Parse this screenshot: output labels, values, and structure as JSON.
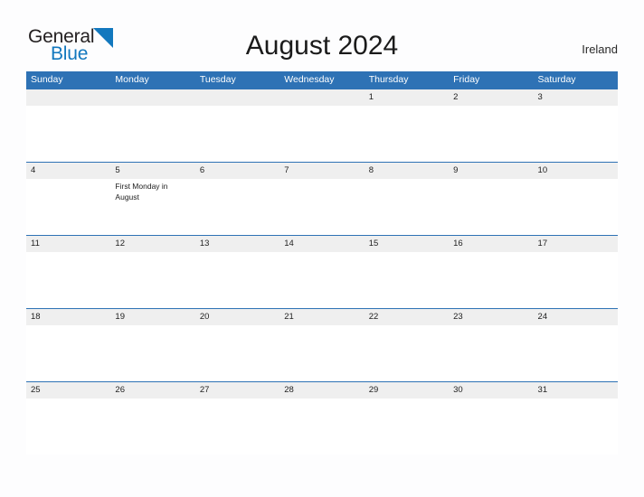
{
  "brand": {
    "name_part1": "General",
    "name_part2": "Blue",
    "flag_icon": "blue-triangle-flag-icon",
    "color_text": "#231f20",
    "color_accent": "#1278be"
  },
  "header": {
    "title": "August 2024",
    "country": "Ireland"
  },
  "calendar": {
    "header_bg": "#2e72b5",
    "band_bg": "#efefef",
    "weekdays": [
      "Sunday",
      "Monday",
      "Tuesday",
      "Wednesday",
      "Thursday",
      "Friday",
      "Saturday"
    ],
    "weeks": [
      {
        "days": [
          {
            "date": "",
            "events": []
          },
          {
            "date": "",
            "events": []
          },
          {
            "date": "",
            "events": []
          },
          {
            "date": "",
            "events": []
          },
          {
            "date": "1",
            "events": []
          },
          {
            "date": "2",
            "events": []
          },
          {
            "date": "3",
            "events": []
          }
        ]
      },
      {
        "days": [
          {
            "date": "4",
            "events": []
          },
          {
            "date": "5",
            "events": [
              "First Monday in August"
            ]
          },
          {
            "date": "6",
            "events": []
          },
          {
            "date": "7",
            "events": []
          },
          {
            "date": "8",
            "events": []
          },
          {
            "date": "9",
            "events": []
          },
          {
            "date": "10",
            "events": []
          }
        ]
      },
      {
        "days": [
          {
            "date": "11",
            "events": []
          },
          {
            "date": "12",
            "events": []
          },
          {
            "date": "13",
            "events": []
          },
          {
            "date": "14",
            "events": []
          },
          {
            "date": "15",
            "events": []
          },
          {
            "date": "16",
            "events": []
          },
          {
            "date": "17",
            "events": []
          }
        ]
      },
      {
        "days": [
          {
            "date": "18",
            "events": []
          },
          {
            "date": "19",
            "events": []
          },
          {
            "date": "20",
            "events": []
          },
          {
            "date": "21",
            "events": []
          },
          {
            "date": "22",
            "events": []
          },
          {
            "date": "23",
            "events": []
          },
          {
            "date": "24",
            "events": []
          }
        ]
      },
      {
        "days": [
          {
            "date": "25",
            "events": []
          },
          {
            "date": "26",
            "events": []
          },
          {
            "date": "27",
            "events": []
          },
          {
            "date": "28",
            "events": []
          },
          {
            "date": "29",
            "events": []
          },
          {
            "date": "30",
            "events": []
          },
          {
            "date": "31",
            "events": []
          }
        ]
      }
    ]
  }
}
